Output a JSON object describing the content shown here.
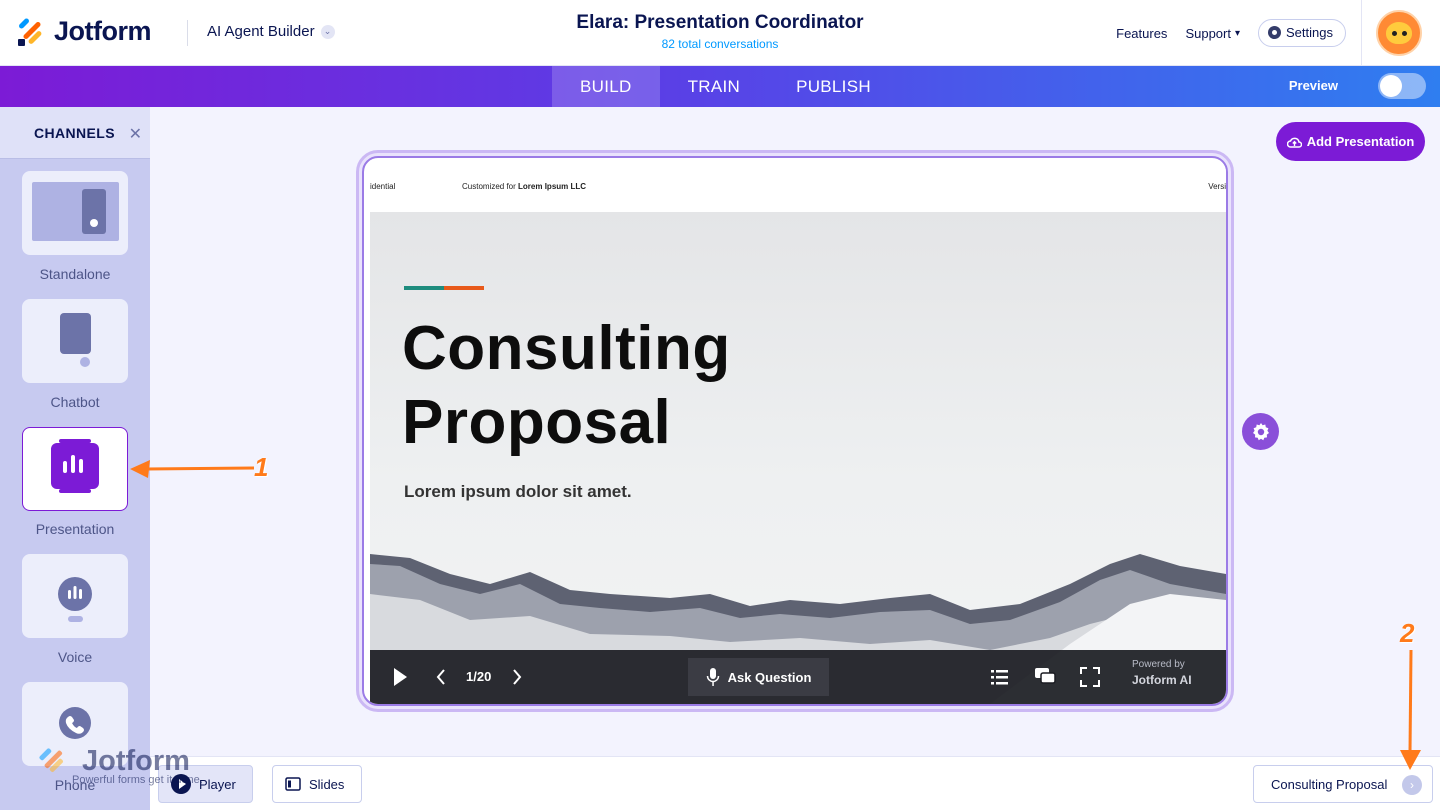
{
  "header": {
    "brand": "Jotform",
    "builder": "AI Agent Builder",
    "agent_title": "Elara: Presentation Coordinator",
    "conversations": "82 total conversations",
    "nav": {
      "features": "Features",
      "support": "Support",
      "settings": "Settings"
    }
  },
  "band": {
    "tabs": [
      {
        "label": "BUILD"
      },
      {
        "label": "TRAIN"
      },
      {
        "label": "PUBLISH"
      }
    ],
    "preview": "Preview"
  },
  "sidebar": {
    "title": "CHANNELS",
    "items": [
      {
        "label": "Standalone"
      },
      {
        "label": "Chatbot"
      },
      {
        "label": "Presentation"
      },
      {
        "label": "Voice"
      },
      {
        "label": "Phone"
      }
    ]
  },
  "main": {
    "add_button": "Add Presentation",
    "slide": {
      "top_left": "idential",
      "customized_prefix": "Customized for",
      "customized_company": "Lorem Ipsum LLC",
      "top_right": "Versi",
      "title_line1": "Consulting",
      "title_line2": "Proposal",
      "subtitle": "Lorem ipsum dolor sit amet.",
      "page": "1/20",
      "ask": "Ask Question",
      "powered_by": "Powered by",
      "powered_brand": "Jotform AI"
    }
  },
  "footer": {
    "player": "Player",
    "slides": "Slides",
    "doc": "Consulting Proposal"
  },
  "watermark": {
    "brand": "Jotform",
    "tagline": "Powerful forms get it done."
  },
  "annotations": {
    "one": "1",
    "two": "2"
  },
  "colors": {
    "accent": "#7c1bd6",
    "annotation": "#ff7a1a",
    "brand_navy": "#0a1551",
    "link": "#0099ff"
  }
}
